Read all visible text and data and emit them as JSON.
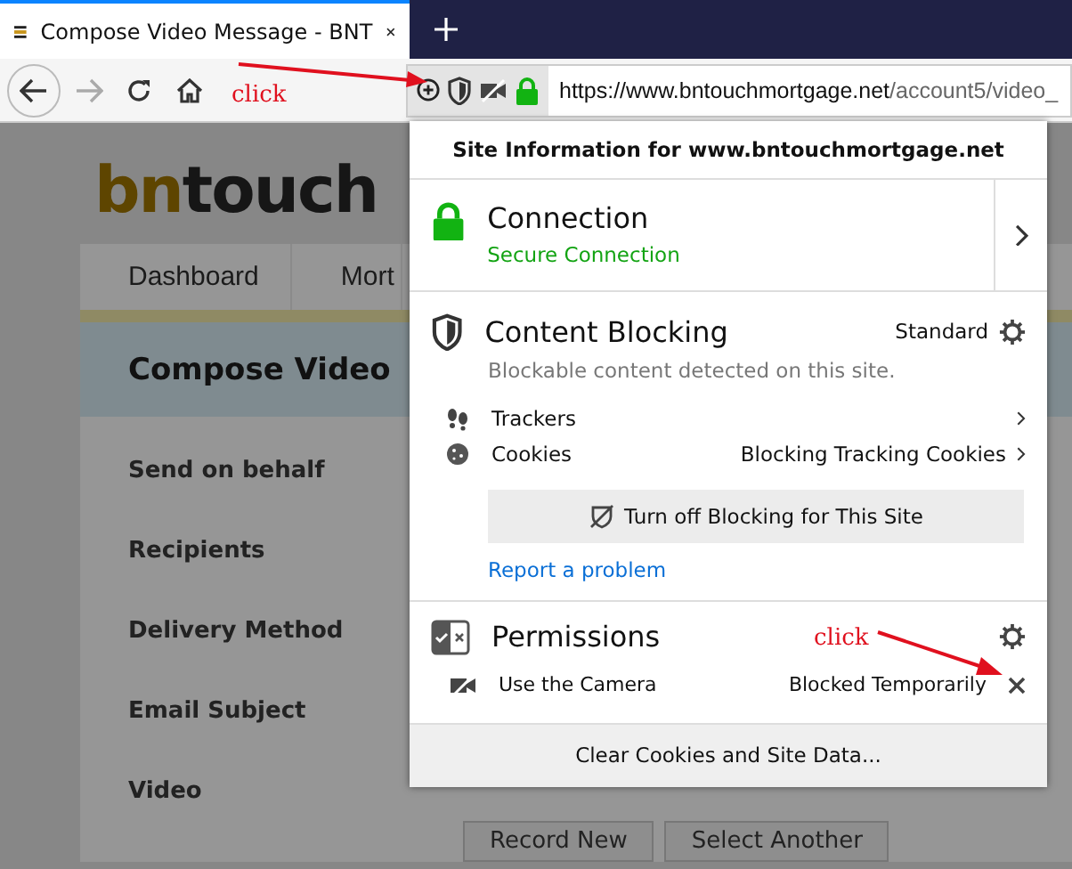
{
  "browser_tab": {
    "title": "Compose Video Message - BNT"
  },
  "address_bar": {
    "url_host": "https://www.bntouchmortgage.net",
    "url_path": "/account5/video_"
  },
  "page": {
    "logo": {
      "first": "bn",
      "second": "touch"
    },
    "nav_tabs": [
      "Dashboard",
      "Mort"
    ],
    "heading": "Compose Video",
    "fields": [
      "Send on behalf",
      "Recipients",
      "Delivery Method",
      "Email Subject",
      "Video"
    ],
    "buttons": [
      "Record New",
      "Select Another"
    ]
  },
  "site_info": {
    "title": "Site Information for www.bntouchmortgage.net",
    "connection": {
      "title": "Connection",
      "status": "Secure Connection"
    },
    "content_blocking": {
      "title": "Content Blocking",
      "mode": "Standard",
      "description": "Blockable content detected on this site.",
      "items": [
        {
          "kind": "trackers",
          "label": "Trackers"
        },
        {
          "kind": "cookies",
          "label": "Cookies",
          "value": "Blocking Tracking Cookies"
        }
      ],
      "turn_off_button": "Turn off Blocking for This Site",
      "report_link": "Report a problem"
    },
    "permissions": {
      "title": "Permissions",
      "items": [
        {
          "label": "Use the Camera",
          "state": "Blocked Temporarily"
        }
      ]
    },
    "footer_button": "Clear Cookies and Site Data..."
  },
  "annotations": [
    {
      "text": "click"
    },
    {
      "text": "click"
    }
  ]
}
